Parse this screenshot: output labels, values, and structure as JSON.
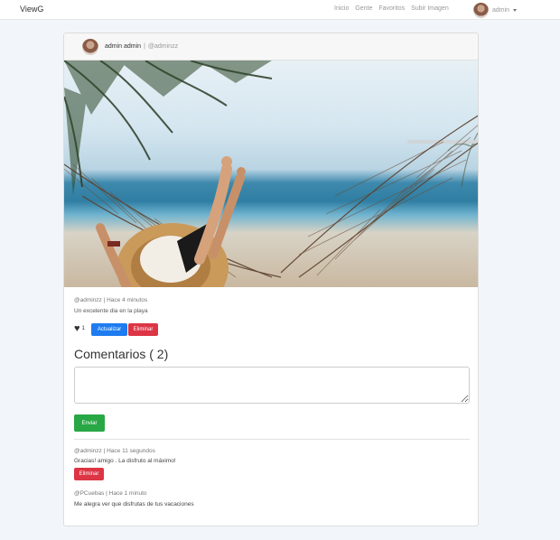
{
  "navbar": {
    "brand": "ViewG",
    "links": [
      "Inicio",
      "Gente",
      "Favoritos",
      "Subir Imagen"
    ],
    "user": "admin"
  },
  "post": {
    "author_name": "admin admin",
    "separator": "|",
    "author_handle": "@adminzz",
    "meta": "@adminzz | Hace 4 minutos",
    "description": "Un excelente dia en la playa",
    "like_count": "1",
    "update_label": "Actualizar",
    "delete_label": "Eliminar"
  },
  "comments": {
    "title": "Comentarios ( 2)",
    "textarea_value": "",
    "submit_label": "Enviar",
    "items": [
      {
        "meta": "@adminzz | Hace 11 segundos",
        "text": "Gracias! amigo . La disfruto al máximo!",
        "delete_label": "Eliminar"
      },
      {
        "meta": "@PCuebas | Hace 1 minuto",
        "text": "Me alegra ver que disfrutas de tus vacaciones"
      }
    ]
  },
  "icons": {
    "like": "heart-icon",
    "dropdown": "caret-down-icon"
  },
  "colors": {
    "primary": "#1e7cf0",
    "danger": "#dc3545",
    "success": "#28a745"
  }
}
